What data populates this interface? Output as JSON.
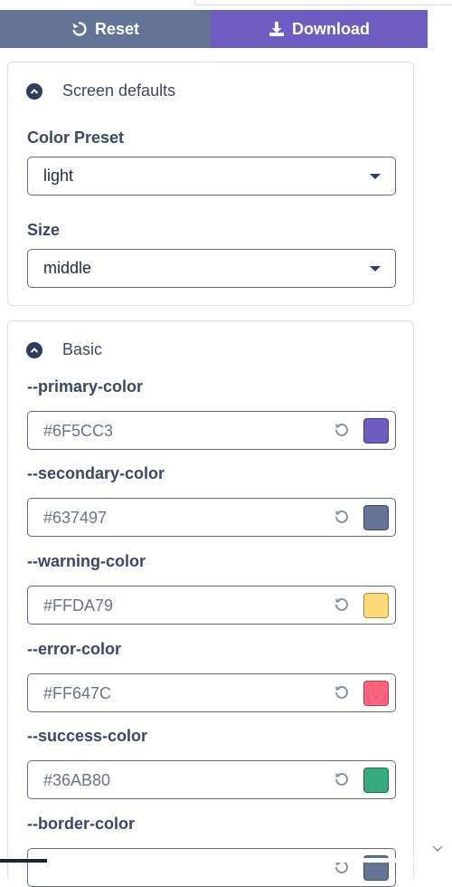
{
  "toolbar": {
    "reset_label": "Reset",
    "download_label": "Download",
    "reset_color": "#637497",
    "download_color": "#6F5CC3"
  },
  "screen_defaults": {
    "title": "Screen defaults",
    "color_preset_label": "Color Preset",
    "color_preset_value": "light",
    "size_label": "Size",
    "size_value": "middle"
  },
  "basic": {
    "title": "Basic",
    "colors": [
      {
        "name": "--primary-color",
        "value": "#6F5CC3",
        "swatch": "#6F5CC3"
      },
      {
        "name": "--secondary-color",
        "value": "#637497",
        "swatch": "#637497"
      },
      {
        "name": "--warning-color",
        "value": "#FFDA79",
        "swatch": "#FFDA79"
      },
      {
        "name": "--error-color",
        "value": "#FF647C",
        "swatch": "#FF647C"
      },
      {
        "name": "--success-color",
        "value": "#36AB80",
        "swatch": "#36AB80"
      },
      {
        "name": "--border-color",
        "value": "",
        "swatch": "#637497"
      }
    ]
  }
}
